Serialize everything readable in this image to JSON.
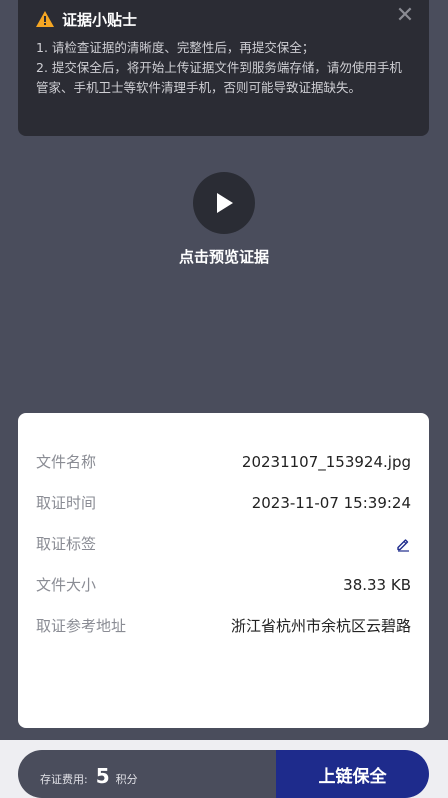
{
  "tips": {
    "title": "证据小贴士",
    "close_icon": "close-icon",
    "lines": [
      "1. 请检查证据的清晰度、完整性后，再提交保全；",
      "2. 提交保全后，将开始上传证据文件到服务端存储，请勿使用手机管家、手机卫士等软件清理手机，否则可能导致证据缺失。"
    ],
    "warning_color": "#f5a623"
  },
  "preview": {
    "label": "点击预览证据",
    "icon": "play-icon"
  },
  "evidence_info": {
    "rows": [
      {
        "label": "文件名称",
        "value": "20231107_153924.jpg"
      },
      {
        "label": "取证时间",
        "value": "2023-11-07 15:39:24"
      },
      {
        "label": "取证标签",
        "value": ""
      },
      {
        "label": "文件大小",
        "value": "38.33 KB"
      },
      {
        "label": "取证参考地址",
        "value": "浙江省杭州市余杭区云碧路"
      }
    ],
    "edit_icon": "pencil-icon"
  },
  "footer": {
    "fee_label": "存证费用:",
    "fee_amount": "5",
    "fee_unit": "积分",
    "submit_label": "上链保全",
    "accent_color": "#1e2b8c"
  }
}
